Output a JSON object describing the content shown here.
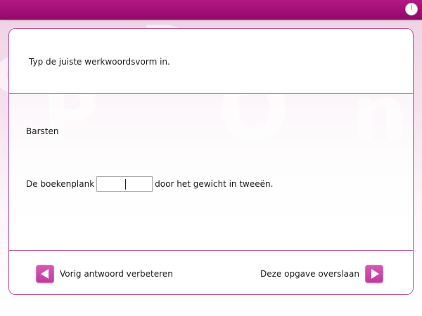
{
  "header": {
    "clock_icon": "clock-icon"
  },
  "question": {
    "instruction": "Typ de juiste werkwoordsvorm in.",
    "verb": "Barsten",
    "sentence_before": "De boekenplank",
    "sentence_after": "door het gewicht in tweeën.",
    "answer_value": ""
  },
  "footer": {
    "prev_label": "Vorig antwoord verbeteren",
    "next_label": "Deze opgave overslaan",
    "prev_icon": "arrow-left-icon",
    "next_icon": "arrow-right-icon"
  },
  "colors": {
    "accent": "#a20f76",
    "button": "#c94aa8",
    "border": "#b84f9b"
  }
}
